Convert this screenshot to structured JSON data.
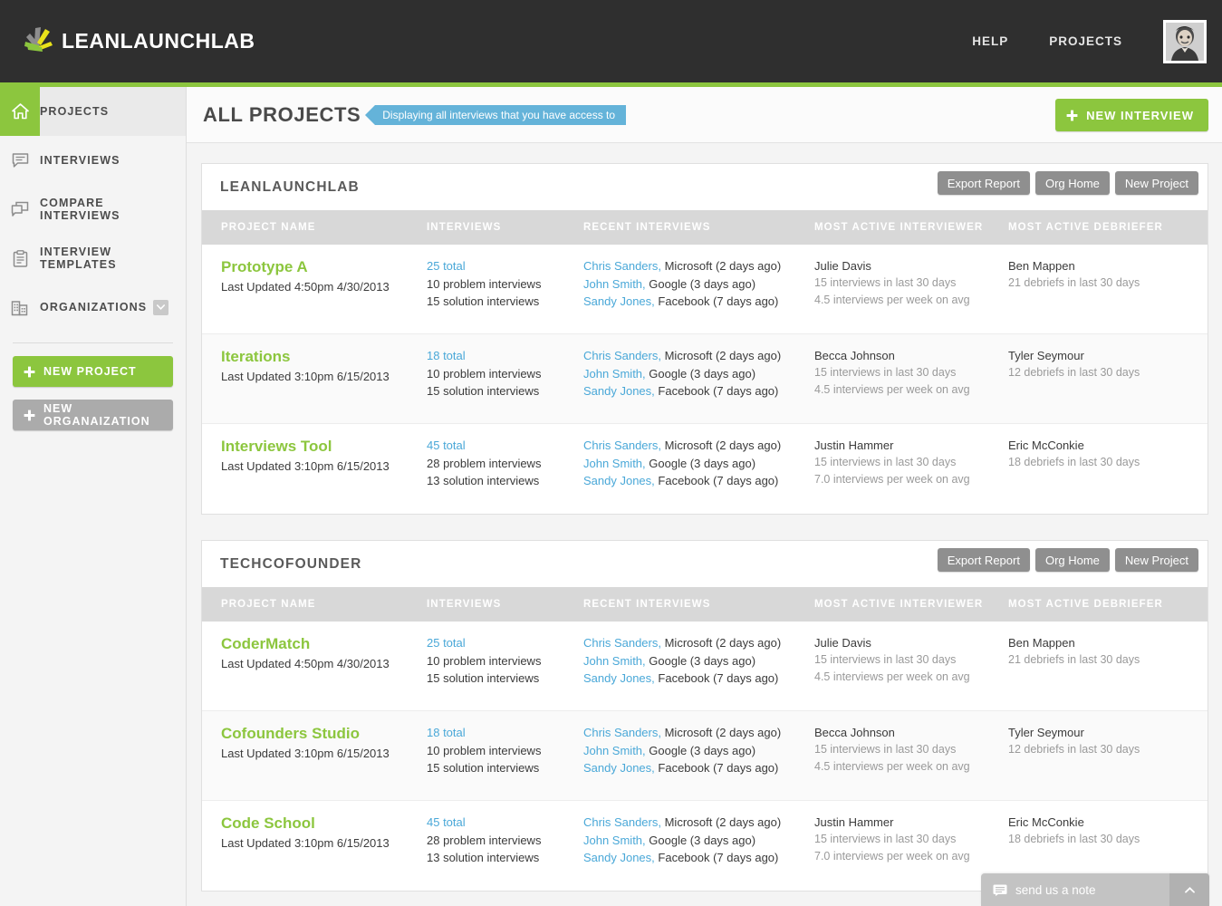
{
  "header": {
    "logo_text": "LEANLAUNCHLAB",
    "nav": [
      {
        "label": "HELP",
        "name": "help"
      },
      {
        "label": "PROJECTS",
        "name": "projects"
      }
    ],
    "avatar_icon": "user-avatar-photo"
  },
  "sidebar": {
    "items": [
      {
        "label": "PROJECTS",
        "icon": "home-icon",
        "active": true
      },
      {
        "label": "INTERVIEWS",
        "icon": "speech-bubble-icon",
        "active": false
      },
      {
        "label": "COMPARE INTERVIEWS",
        "icon": "compare-bubbles-icon",
        "active": false
      },
      {
        "label": "INTERVIEW TEMPLATES",
        "icon": "clipboard-icon",
        "active": false
      },
      {
        "label": "ORGANIZATIONS",
        "icon": "building-icon",
        "active": false,
        "chevron": "chevron-down-icon"
      }
    ],
    "buttons": [
      {
        "label": "NEW PROJECT",
        "style": "green",
        "icon": "plus-icon"
      },
      {
        "label": "NEW ORGANAIZATION",
        "style": "gray",
        "icon": "plus-icon"
      }
    ]
  },
  "page": {
    "title": "ALL PROJECTS",
    "ribbon": "Displaying all interviews that you have access to",
    "new_interview_label": "NEW INTERVIEW"
  },
  "columns": [
    "PROJECT NAME",
    "INTERVIEWS",
    "RECENT INTERVIEWS",
    "MOST ACTIVE INTERVIEWER",
    "MOST ACTIVE DEBRIEFER"
  ],
  "panel_actions": [
    "Export Report",
    "Org Home",
    "New Project"
  ],
  "panels": [
    {
      "title": "LEANLAUNCHLAB",
      "rows": [
        {
          "name": "Prototype A",
          "updated": "Last Updated 4:50pm 4/30/2013",
          "total": "25 total",
          "problem": "10 problem interviews",
          "solution": "15 solution interviews",
          "recent": [
            {
              "person": "Chris Sanders,",
              "detail": " Microsoft (2 days ago)"
            },
            {
              "person": "John Smith,",
              "detail": " Google (3 days ago)"
            },
            {
              "person": "Sandy Jones,",
              "detail": " Facebook (7 days ago)"
            }
          ],
          "interviewer": "Julie Davis",
          "interviewer_stat1": "15 interviews in last 30 days",
          "interviewer_stat2": "4.5 interviews per week on avg",
          "debriefer": "Ben Mappen",
          "debriefer_stat1": "21 debriefs in last 30 days"
        },
        {
          "name": "Iterations",
          "updated": "Last Updated 3:10pm 6/15/2013",
          "total": "18 total",
          "problem": "10 problem interviews",
          "solution": "15 solution interviews",
          "recent": [
            {
              "person": "Chris Sanders,",
              "detail": " Microsoft (2 days ago)"
            },
            {
              "person": "John Smith,",
              "detail": " Google (3 days ago)"
            },
            {
              "person": "Sandy Jones,",
              "detail": " Facebook (7 days ago)"
            }
          ],
          "interviewer": "Becca Johnson",
          "interviewer_stat1": "15 interviews in last 30 days",
          "interviewer_stat2": "4.5 interviews per week on avg",
          "debriefer": "Tyler Seymour",
          "debriefer_stat1": "12 debriefs in last 30 days"
        },
        {
          "name": "Interviews Tool",
          "updated": "Last Updated 3:10pm 6/15/2013",
          "total": "45 total",
          "problem": "28 problem interviews",
          "solution": "13 solution interviews",
          "recent": [
            {
              "person": "Chris Sanders,",
              "detail": " Microsoft (2 days ago)"
            },
            {
              "person": "John Smith,",
              "detail": " Google (3 days ago)"
            },
            {
              "person": "Sandy Jones,",
              "detail": " Facebook (7 days ago)"
            }
          ],
          "interviewer": "Justin Hammer",
          "interviewer_stat1": "15 interviews in last 30 days",
          "interviewer_stat2": "7.0 interviews per week on avg",
          "debriefer": "Eric McConkie",
          "debriefer_stat1": "18 debriefs in last 30 days"
        }
      ]
    },
    {
      "title": "TECHCOFOUNDER",
      "rows": [
        {
          "name": "CoderMatch",
          "updated": "Last Updated 4:50pm 4/30/2013",
          "total": "25 total",
          "problem": "10 problem interviews",
          "solution": "15 solution interviews",
          "recent": [
            {
              "person": "Chris Sanders,",
              "detail": " Microsoft (2 days ago)"
            },
            {
              "person": "John Smith,",
              "detail": " Google (3 days ago)"
            },
            {
              "person": "Sandy Jones,",
              "detail": " Facebook (7 days ago)"
            }
          ],
          "interviewer": "Julie Davis",
          "interviewer_stat1": "15 interviews in last 30 days",
          "interviewer_stat2": "4.5 interviews per week on avg",
          "debriefer": "Ben Mappen",
          "debriefer_stat1": "21 debriefs in last 30 days"
        },
        {
          "name": "Cofounders Studio",
          "updated": "Last Updated 3:10pm 6/15/2013",
          "total": "18 total",
          "problem": "10 problem interviews",
          "solution": "15 solution interviews",
          "recent": [
            {
              "person": "Chris Sanders,",
              "detail": " Microsoft (2 days ago)"
            },
            {
              "person": "John Smith,",
              "detail": " Google (3 days ago)"
            },
            {
              "person": "Sandy Jones,",
              "detail": " Facebook (7 days ago)"
            }
          ],
          "interviewer": "Becca Johnson",
          "interviewer_stat1": "15 interviews in last 30 days",
          "interviewer_stat2": "4.5 interviews per week on avg",
          "debriefer": "Tyler Seymour",
          "debriefer_stat1": "12 debriefs in last 30 days"
        },
        {
          "name": "Code School",
          "updated": "Last Updated 3:10pm 6/15/2013",
          "total": "45 total",
          "problem": "28 problem interviews",
          "solution": "13 solution interviews",
          "recent": [
            {
              "person": "Chris Sanders,",
              "detail": " Microsoft (2 days ago)"
            },
            {
              "person": "John Smith,",
              "detail": " Google (3 days ago)"
            },
            {
              "person": "Sandy Jones,",
              "detail": " Facebook (7 days ago)"
            }
          ],
          "interviewer": "Justin Hammer",
          "interviewer_stat1": "15 interviews in last 30 days",
          "interviewer_stat2": "7.0 interviews per week on avg",
          "debriefer": "Eric McConkie",
          "debriefer_stat1": "18 debriefs in last 30 days"
        }
      ]
    }
  ],
  "chat": {
    "label": "send us a note",
    "icon": "chat-bubble-icon",
    "toggle_icon": "chevron-up-icon"
  },
  "colors": {
    "brand_green": "#8cc63e",
    "link_blue": "#4aa8d8",
    "ribbon_blue": "#64b3d9",
    "header_dark": "#2f2f2f"
  }
}
